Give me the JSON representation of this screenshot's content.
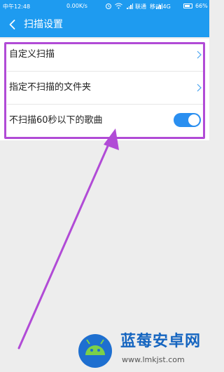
{
  "status_bar": {
    "time": "中午12:48",
    "speed": "0.00K/s",
    "carrier1": "联通",
    "carrier2": "移动 4G",
    "battery": "66%"
  },
  "header": {
    "title": "扫描设置"
  },
  "settings": {
    "items": [
      {
        "label": "自定义扫描",
        "type": "link"
      },
      {
        "label": "指定不扫描的文件夹",
        "type": "link"
      },
      {
        "label": "不扫描60秒以下的歌曲",
        "type": "toggle",
        "enabled": true
      }
    ]
  },
  "colors": {
    "accent": "#1e9bf0",
    "annotation": "#b14bd6"
  },
  "watermark": {
    "brand": "蓝莓安卓网",
    "url": "www.lmkjst.com"
  }
}
